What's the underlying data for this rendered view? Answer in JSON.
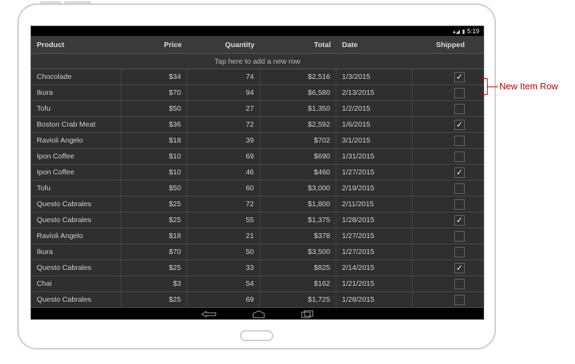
{
  "status_bar": {
    "time": "5:19",
    "signal_icon": "signal-icon",
    "battery_icon": "battery-icon"
  },
  "grid": {
    "columns": {
      "product": "Product",
      "price": "Price",
      "quantity": "Quantity",
      "total": "Total",
      "date": "Date",
      "shipped": "Shipped"
    },
    "new_row_text": "Tap here to add a new row",
    "rows": [
      {
        "product": "Chocolade",
        "price": "$34",
        "quantity": "74",
        "total": "$2,516",
        "date": "1/3/2015",
        "shipped": true
      },
      {
        "product": "Ikura",
        "price": "$70",
        "quantity": "94",
        "total": "$6,580",
        "date": "2/13/2015",
        "shipped": false
      },
      {
        "product": "Tofu",
        "price": "$50",
        "quantity": "27",
        "total": "$1,350",
        "date": "1/2/2015",
        "shipped": false
      },
      {
        "product": "Boston Crab Meat",
        "price": "$36",
        "quantity": "72",
        "total": "$2,592",
        "date": "1/6/2015",
        "shipped": true
      },
      {
        "product": "Ravioli Angelo",
        "price": "$18",
        "quantity": "39",
        "total": "$702",
        "date": "3/1/2015",
        "shipped": false
      },
      {
        "product": "Ipon Coffee",
        "price": "$10",
        "quantity": "69",
        "total": "$690",
        "date": "1/31/2015",
        "shipped": false
      },
      {
        "product": "Ipon Coffee",
        "price": "$10",
        "quantity": "46",
        "total": "$460",
        "date": "1/27/2015",
        "shipped": true
      },
      {
        "product": "Tofu",
        "price": "$50",
        "quantity": "60",
        "total": "$3,000",
        "date": "2/19/2015",
        "shipped": false
      },
      {
        "product": "Questo Cabrales",
        "price": "$25",
        "quantity": "72",
        "total": "$1,800",
        "date": "2/11/2015",
        "shipped": false
      },
      {
        "product": "Questo Cabrales",
        "price": "$25",
        "quantity": "55",
        "total": "$1,375",
        "date": "1/28/2015",
        "shipped": true
      },
      {
        "product": "Ravioli Angelo",
        "price": "$18",
        "quantity": "21",
        "total": "$378",
        "date": "1/27/2015",
        "shipped": false
      },
      {
        "product": "Ikura",
        "price": "$70",
        "quantity": "50",
        "total": "$3,500",
        "date": "1/27/2015",
        "shipped": false
      },
      {
        "product": "Questo Cabrales",
        "price": "$25",
        "quantity": "33",
        "total": "$825",
        "date": "2/14/2015",
        "shipped": true
      },
      {
        "product": "Chai",
        "price": "$3",
        "quantity": "54",
        "total": "$162",
        "date": "1/21/2015",
        "shipped": false
      },
      {
        "product": "Questo Cabrales",
        "price": "$25",
        "quantity": "69",
        "total": "$1,725",
        "date": "1/28/2015",
        "shipped": false
      }
    ]
  },
  "callout": {
    "label": "New Item Row"
  }
}
